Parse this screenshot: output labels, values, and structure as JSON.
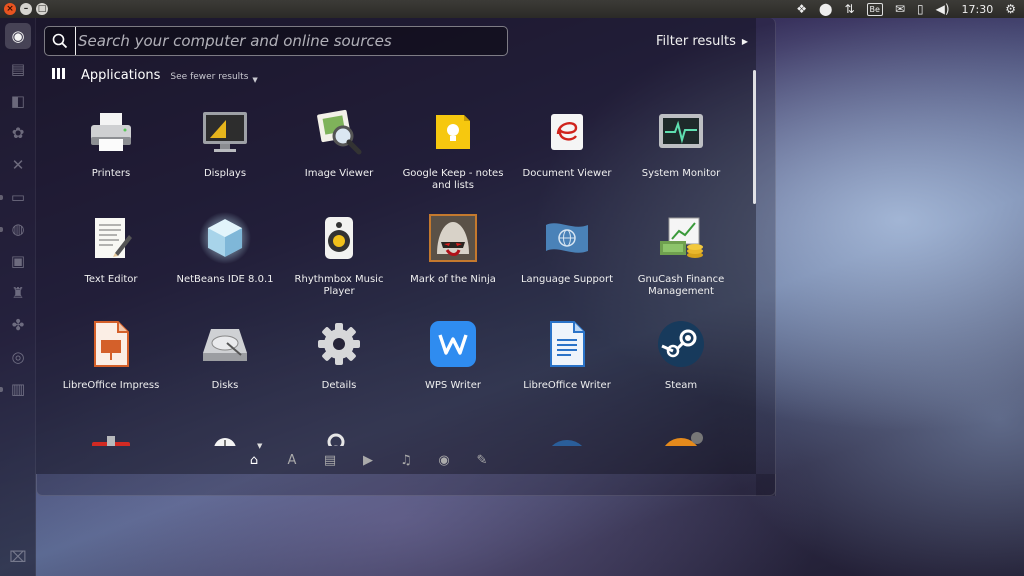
{
  "top_panel": {
    "clock": "17:30",
    "indicators": [
      {
        "name": "dropbox-icon",
        "glyph": "❖"
      },
      {
        "name": "status-circle-icon",
        "glyph": "⬤"
      },
      {
        "name": "network-icon",
        "glyph": "⇅"
      },
      {
        "name": "behance-icon",
        "glyph": "Be"
      },
      {
        "name": "mail-icon",
        "glyph": "✉"
      },
      {
        "name": "battery-icon",
        "glyph": "▯"
      },
      {
        "name": "volume-icon",
        "glyph": "◀)"
      }
    ]
  },
  "dash": {
    "search_placeholder": "Search your computer and online sources",
    "filter_label": "Filter results",
    "category_title": "Applications",
    "see_fewer": "See fewer results"
  },
  "apps": [
    {
      "label": "Printers",
      "icon": "printer"
    },
    {
      "label": "Displays",
      "icon": "displays"
    },
    {
      "label": "Image Viewer",
      "icon": "image-viewer"
    },
    {
      "label": "Google Keep - notes and lists",
      "icon": "google-keep"
    },
    {
      "label": "Document Viewer",
      "icon": "document-viewer"
    },
    {
      "label": "System Monitor",
      "icon": "system-monitor"
    },
    {
      "label": "Text Editor",
      "icon": "text-editor"
    },
    {
      "label": "NetBeans IDE 8.0.1",
      "icon": "netbeans"
    },
    {
      "label": "Rhythmbox Music Player",
      "icon": "rhythmbox"
    },
    {
      "label": "Mark of the Ninja",
      "icon": "ninja"
    },
    {
      "label": "Language Support",
      "icon": "language-support"
    },
    {
      "label": "GnuCash Finance Management",
      "icon": "gnucash"
    },
    {
      "label": "LibreOffice Impress",
      "icon": "impress"
    },
    {
      "label": "Disks",
      "icon": "disks"
    },
    {
      "label": "Details",
      "icon": "details"
    },
    {
      "label": "WPS Writer",
      "icon": "wps-writer"
    },
    {
      "label": "LibreOffice Writer",
      "icon": "writer"
    },
    {
      "label": "Steam",
      "icon": "steam"
    },
    {
      "label": "",
      "icon": "red-tool"
    },
    {
      "label": "",
      "icon": "mouse"
    },
    {
      "label": "",
      "icon": "bluetooth-key"
    },
    {
      "label": "",
      "icon": "archive"
    },
    {
      "label": "",
      "icon": "blue-round"
    },
    {
      "label": "",
      "icon": "half-life"
    }
  ],
  "lenses": [
    {
      "name": "home-lens-icon",
      "glyph": "⌂",
      "active": true
    },
    {
      "name": "applications-lens-icon",
      "glyph": "A",
      "active": false
    },
    {
      "name": "files-lens-icon",
      "glyph": "▤",
      "active": false
    },
    {
      "name": "video-lens-icon",
      "glyph": "▶",
      "active": false
    },
    {
      "name": "music-lens-icon",
      "glyph": "♫",
      "active": false
    },
    {
      "name": "photos-lens-icon",
      "glyph": "◉",
      "active": false
    },
    {
      "name": "social-lens-icon",
      "glyph": "✎",
      "active": false
    }
  ],
  "launcher": [
    {
      "name": "dash-home-icon",
      "glyph": "◉"
    },
    {
      "name": "files-icon",
      "glyph": "▤"
    },
    {
      "name": "software-center-icon",
      "glyph": "◧"
    },
    {
      "name": "settings-icon",
      "glyph": "✿"
    },
    {
      "name": "tools-icon",
      "glyph": "✕"
    },
    {
      "name": "terminal-icon",
      "glyph": "▭"
    },
    {
      "name": "browser-icon",
      "glyph": "◍"
    },
    {
      "name": "image-editor-icon",
      "glyph": "▣"
    },
    {
      "name": "popcorn-icon",
      "glyph": "♜"
    },
    {
      "name": "pinwheel-icon",
      "glyph": "✤"
    },
    {
      "name": "disk-icon",
      "glyph": "◎"
    },
    {
      "name": "text-icon",
      "glyph": "▥"
    },
    {
      "name": "trash-icon",
      "glyph": "⌧"
    }
  ]
}
